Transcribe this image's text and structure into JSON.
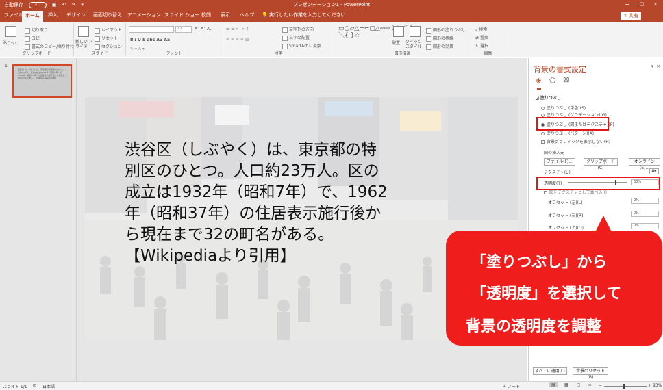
{
  "titlebar": {
    "autosave": "自動保存",
    "toggle": "オフ",
    "title": "プレゼンテーション1 - PowerPoint",
    "controls": [
      "ー",
      "□",
      "×"
    ]
  },
  "tabs": [
    {
      "label": "ファイル"
    },
    {
      "label": "ホーム"
    },
    {
      "label": "挿入"
    },
    {
      "label": "デザイン"
    },
    {
      "label": "画面切り替え"
    },
    {
      "label": "アニメーション"
    },
    {
      "label": "スライド ショー"
    },
    {
      "label": "校閲"
    },
    {
      "label": "表示"
    },
    {
      "label": "ヘルプ"
    },
    {
      "label": "実行したい作業を入力してください"
    }
  ],
  "share_label": "共有",
  "ribbon": {
    "clipboard": {
      "paste": "貼り付け",
      "cut": "切り取り",
      "copy": "コピー",
      "format_painter": "書式のコピー/貼り付け",
      "label": "クリップボード"
    },
    "slides": {
      "new_slide": "新しい スライド",
      "layout": "レイアウト",
      "reset": "リセット",
      "section": "セクション",
      "label": "スライド"
    },
    "font": {
      "size": "44",
      "label": "フォント"
    },
    "paragraph": {
      "text_direction": "文字列の方向",
      "align_text": "文字の配置",
      "smartart": "SmartArt に変換",
      "label": "段落"
    },
    "drawing": {
      "arrange": "配置",
      "quick_styles": "クイック スタイル",
      "fill": "図形の塗りつぶし",
      "outline": "図形の枠線",
      "effects": "図形の効果",
      "label": "図形描画"
    },
    "editing": {
      "find": "検索",
      "replace": "置換",
      "select": "選択",
      "label": "編集"
    }
  },
  "slide_panel": {
    "number": "1",
    "thumb_text": "渋谷区（しぶやく）は、東京都の特別区のひとつ。人口約23万人。区の成立は1932年（昭和7年）で、1962年（昭和37年）の住居表示施行後から現在まで32の町名がある。【Wikipediaより引用】"
  },
  "slide": {
    "lines": [
      "渋谷区（しぶやく）は、東京都の特",
      "別区のひとつ。人口約23万人。区の",
      "成立は1932年（昭和7年）で、1962",
      "年（昭和37年）の住居表示施行後か",
      "ら現在まで32の町名がある。",
      "【Wikipediaより引用】"
    ]
  },
  "callout": {
    "line1": "「塗りつぶし」から",
    "line2": "「透明度」を選択して",
    "line3": "背景の透明度を調整"
  },
  "format_pane": {
    "title": "背景の書式設定",
    "section": "塗りつぶし",
    "options": [
      {
        "label": "塗りつぶし (単色)(S)",
        "selected": false
      },
      {
        "label": "塗りつぶし (グラデーション)(G)",
        "selected": false
      },
      {
        "label": "塗りつぶし (図またはテクスチャ)(P)",
        "selected": true
      },
      {
        "label": "塗りつぶし (パターン)(A)",
        "selected": false
      }
    ],
    "hide_graphics": "背景グラフィックを表示しない(H)",
    "insert_from": "図の挿入元",
    "file_button": "ファイル(F)...",
    "clipboard_button": "クリップボード(C)",
    "online_button": "オンライン(E)...",
    "texture_label": "テクスチャ(U)",
    "transparency_label": "透明度(T)",
    "transparency_value": "80%",
    "transparency_fraction": 0.8,
    "tile_label": "図をテクスチャとして並べる(I)",
    "offsets": [
      {
        "label": "オフセット (左)(L)",
        "value": "0%"
      },
      {
        "label": "オフセット (右)(R)",
        "value": "0%"
      },
      {
        "label": "オフセット (上)(O)",
        "value": "0%"
      }
    ],
    "apply_all": "すべてに適用(L)",
    "reset_bg": "背景のリセット(B)"
  },
  "statusbar": {
    "slide_info": "スライド 1/1",
    "language": "日本語",
    "notes": "ノート",
    "zoom": "93%"
  },
  "colors": {
    "accent": "#b7472a",
    "callout": "#f01d1d",
    "highlight": "#e51616"
  }
}
